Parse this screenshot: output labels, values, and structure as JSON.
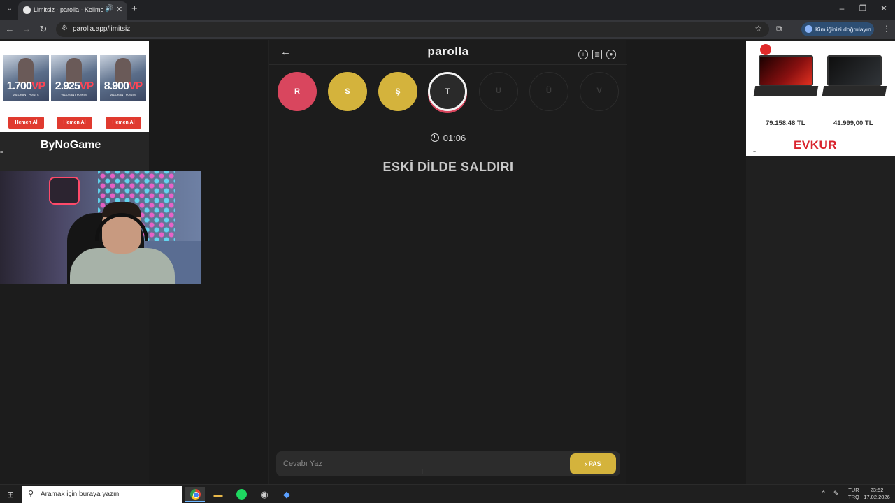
{
  "browser": {
    "tab_title": "Limitsiz - parolla - Kelime o",
    "url": "parolla.app/limitsiz",
    "profile_label": "Kimliğinizi doğrulayın"
  },
  "ad_left": {
    "cards": [
      {
        "amount": "1.700",
        "unit": "VP",
        "sub": "VALORANT POINTS",
        "button": "Hemen Al"
      },
      {
        "amount": "2.925",
        "unit": "VP",
        "sub": "VALORANT POINTS",
        "button": "Hemen Al"
      },
      {
        "amount": "8.900",
        "unit": "VP",
        "sub": "VALORANT POINTS",
        "button": "Hemen Al"
      }
    ],
    "brand": "ByNoGame",
    "mark": "="
  },
  "ad_right": {
    "prices": [
      "79.158,48 TL",
      "41.999,00 TL"
    ],
    "brand": "EVKUR",
    "mark": "="
  },
  "game": {
    "title": "parolla",
    "letters": [
      {
        "char": "R",
        "state": "wrong"
      },
      {
        "char": "S",
        "state": "pass"
      },
      {
        "char": "Ş",
        "state": "pass"
      },
      {
        "char": "T",
        "state": "active"
      },
      {
        "char": "U",
        "state": "pending"
      },
      {
        "char": "Ü",
        "state": "pending"
      },
      {
        "char": "V",
        "state": "pending"
      }
    ],
    "timer": "01:06",
    "question": "ESKİ DİLDE SALDIRI",
    "answer_placeholder": "Cevabı Yaz",
    "pass_label": "PAS",
    "colors": {
      "wrong": "#d9465e",
      "pass": "#d4b33c"
    }
  },
  "taskbar": {
    "search_placeholder": "Aramak için buraya yazın",
    "lang_top": "TUR",
    "lang_bottom": "TRQ",
    "time": "23:52",
    "date": "17.02.2026"
  }
}
